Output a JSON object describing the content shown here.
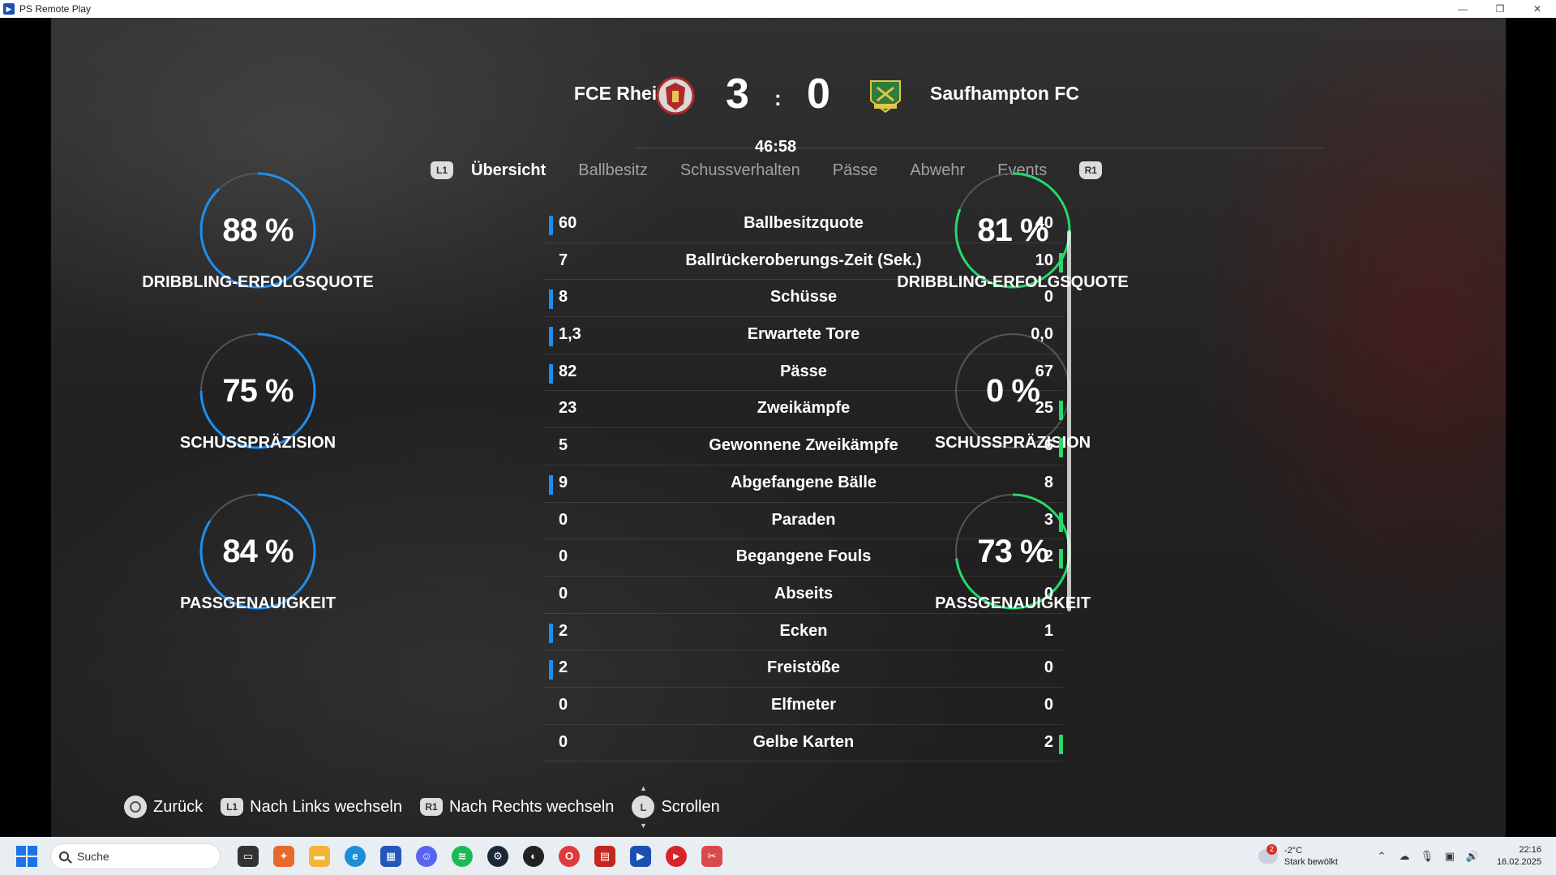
{
  "window": {
    "title": "PS Remote Play",
    "icon": "ps-remote-play-icon"
  },
  "match": {
    "home_team": "FCE Rheine",
    "away_team": "Saufhampton FC",
    "home_score": "3",
    "separator": ":",
    "away_score": "0",
    "time": "46:58"
  },
  "tabs": {
    "l1": "L1",
    "r1": "R1",
    "items": [
      "Übersicht",
      "Ballbesitz",
      "Schussverhalten",
      "Pässe",
      "Abwehr",
      "Events"
    ],
    "active_index": 0
  },
  "home_rings": [
    {
      "value": "88 %",
      "fraction": 0.88,
      "label": "DRIBBLING-ERFOLGSQUOTE"
    },
    {
      "value": "75 %",
      "fraction": 0.75,
      "label": "SCHUSSPRÄZISION"
    },
    {
      "value": "84 %",
      "fraction": 0.84,
      "label": "PASSGENAUIGKEIT"
    }
  ],
  "away_rings": [
    {
      "value": "81 %",
      "fraction": 0.81,
      "label": "DRIBBLING-ERFOLGSQUOTE"
    },
    {
      "value": "0 %",
      "fraction": 0.0,
      "label": "SCHUSSPRÄZISION"
    },
    {
      "value": "73 %",
      "fraction": 0.73,
      "label": "PASSGENAUIGKEIT"
    }
  ],
  "colors": {
    "home": "#1e8ef0",
    "away": "#26d96b",
    "ring_track": "#555555"
  },
  "stats": [
    {
      "name": "Ballbesitzquote",
      "home": "60",
      "away": "40",
      "leader": "home"
    },
    {
      "name": "Ballrückeroberungs-Zeit (Sek.)",
      "home": "7",
      "away": "10",
      "leader": "away"
    },
    {
      "name": "Schüsse",
      "home": "8",
      "away": "0",
      "leader": "home"
    },
    {
      "name": "Erwartete Tore",
      "home": "1,3",
      "away": "0,0",
      "leader": "home"
    },
    {
      "name": "Pässe",
      "home": "82",
      "away": "67",
      "leader": "home"
    },
    {
      "name": "Zweikämpfe",
      "home": "23",
      "away": "25",
      "leader": "away"
    },
    {
      "name": "Gewonnene Zweikämpfe",
      "home": "5",
      "away": "6",
      "leader": "away"
    },
    {
      "name": "Abgefangene Bälle",
      "home": "9",
      "away": "8",
      "leader": "home"
    },
    {
      "name": "Paraden",
      "home": "0",
      "away": "3",
      "leader": "away"
    },
    {
      "name": "Begangene Fouls",
      "home": "0",
      "away": "2",
      "leader": "away"
    },
    {
      "name": "Abseits",
      "home": "0",
      "away": "0",
      "leader": "none"
    },
    {
      "name": "Ecken",
      "home": "2",
      "away": "1",
      "leader": "home"
    },
    {
      "name": "Freistöße",
      "home": "2",
      "away": "0",
      "leader": "home"
    },
    {
      "name": "Elfmeter",
      "home": "0",
      "away": "0",
      "leader": "none"
    },
    {
      "name": "Gelbe Karten",
      "home": "0",
      "away": "2",
      "leader": "away"
    }
  ],
  "hints": {
    "back": "Zurück",
    "left": "Nach Links wechseln",
    "right": "Nach Rechts wechseln",
    "scroll": "Scrollen",
    "l1": "L1",
    "r1": "R1",
    "stick": "L"
  },
  "taskbar": {
    "search_placeholder": "Suche",
    "weather_temp": "-2°C",
    "weather_desc": "Stark bewölkt",
    "weather_badge": "2",
    "time": "22:16",
    "date": "16.02.2025"
  }
}
